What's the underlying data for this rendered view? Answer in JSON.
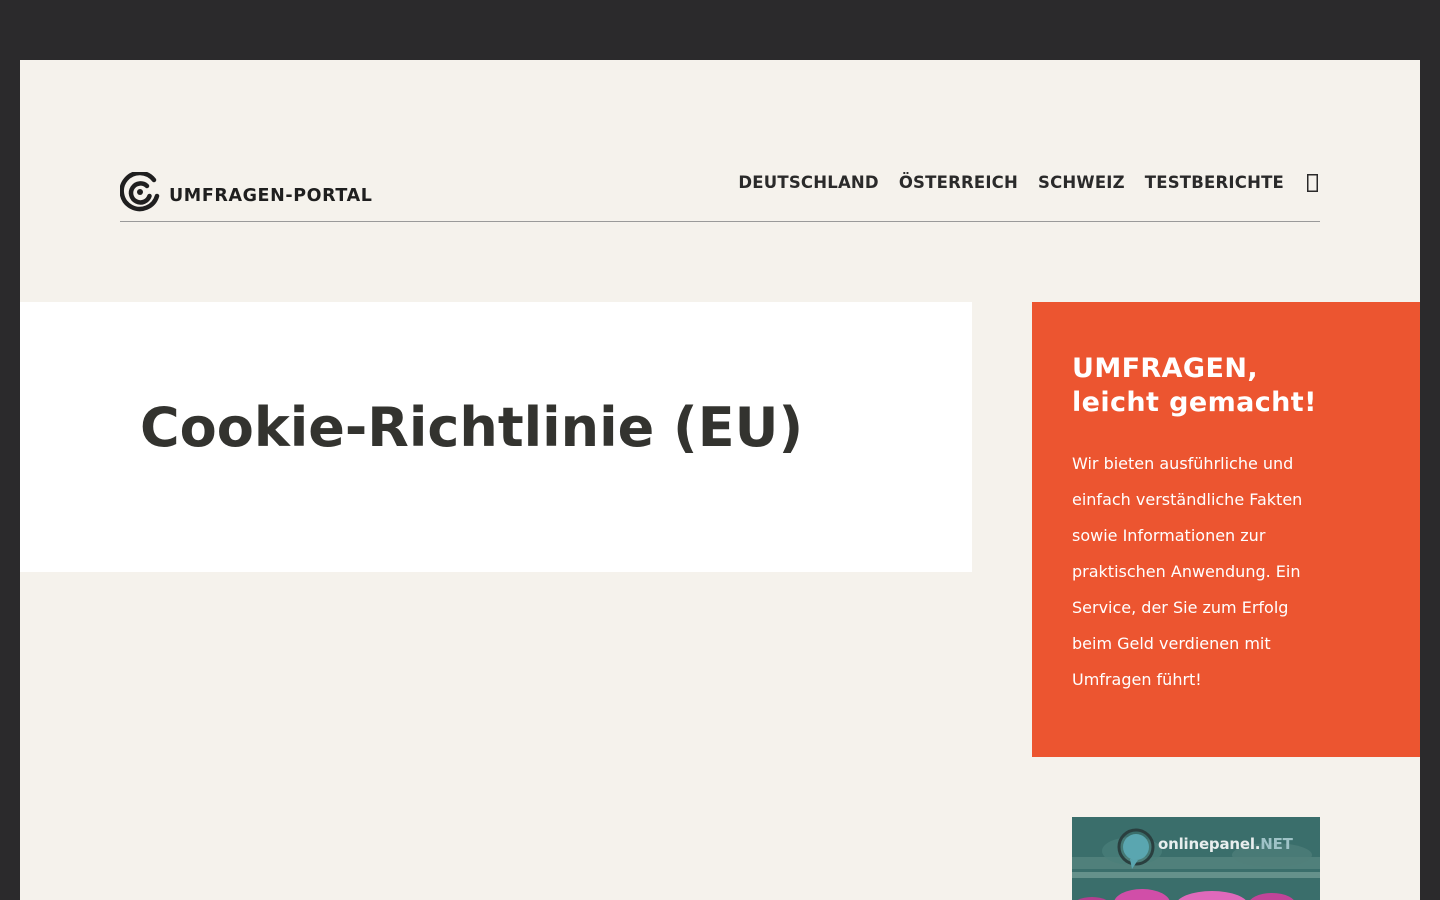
{
  "brand": {
    "name": "UMFRAGEN-PORTAL"
  },
  "nav": {
    "items": [
      "DEUTSCHLAND",
      "ÖSTERREICH",
      "SCHWEIZ",
      "TESTBERICHTE"
    ],
    "search_icon": "search-icon"
  },
  "main": {
    "title": "Cookie-Richtlinie (EU)"
  },
  "promo": {
    "heading_line1": "UMFRAGEN,",
    "heading_line2": "leicht gemacht!",
    "text": "Wir bieten ausführliche und einfach verständliche Fakten sowie Informationen zur praktischen Anwendung. Ein Service, der Sie zum Erfolg beim Geld verdienen mit Umfragen führt!"
  },
  "ad": {
    "brand_text": "onlinepanel.",
    "brand_suffix": "NET"
  },
  "colors": {
    "background_frame": "#2b2a2c",
    "page_bg": "#f5f2ec",
    "card_bg": "#ffffff",
    "accent": "#ec5530",
    "text_dark": "#33332f"
  }
}
